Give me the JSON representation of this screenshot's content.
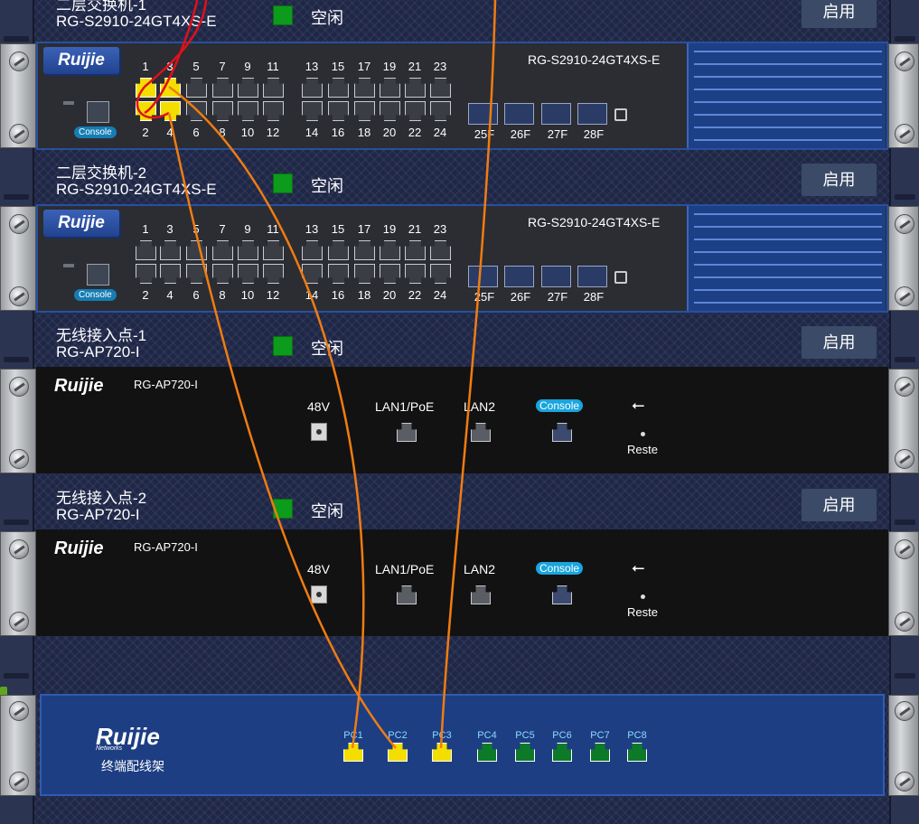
{
  "devices": [
    {
      "name_line1": "二层交换机-1",
      "name_line2": "RG-S2910-24GT4XS-E",
      "status": "空闲",
      "enable_label": "启用",
      "brand": "Ruijie",
      "model": "RG-S2910-24GT4XS-E",
      "console_label": "Console",
      "odd_ports": [
        "1",
        "3",
        "5",
        "7",
        "9",
        "11",
        "13",
        "15",
        "17",
        "19",
        "21",
        "23"
      ],
      "even_ports": [
        "2",
        "4",
        "6",
        "8",
        "10",
        "12",
        "14",
        "16",
        "18",
        "20",
        "22",
        "24"
      ],
      "sfp_ports": [
        "25F",
        "26F",
        "27F",
        "28F"
      ],
      "active_ports": [
        "1",
        "2",
        "3",
        "4"
      ]
    },
    {
      "name_line1": "二层交换机-2",
      "name_line2": "RG-S2910-24GT4XS-E",
      "status": "空闲",
      "enable_label": "启用",
      "brand": "Ruijie",
      "model": "RG-S2910-24GT4XS-E",
      "console_label": "Console",
      "odd_ports": [
        "1",
        "3",
        "5",
        "7",
        "9",
        "11",
        "13",
        "15",
        "17",
        "19",
        "21",
        "23"
      ],
      "even_ports": [
        "2",
        "4",
        "6",
        "8",
        "10",
        "12",
        "14",
        "16",
        "18",
        "20",
        "22",
        "24"
      ],
      "sfp_ports": [
        "25F",
        "26F",
        "27F",
        "28F"
      ],
      "active_ports": []
    },
    {
      "name_line1": "无线接入点-1",
      "name_line2": "RG-AP720-I",
      "status": "空闲",
      "enable_label": "启用",
      "brand": "Ruijie",
      "model": "RG-AP720-I",
      "power_label": "48V",
      "lan1_label": "LAN1/PoE",
      "lan2_label": "LAN2",
      "console_label": "Console",
      "reset_label": "Reste"
    },
    {
      "name_line1": "无线接入点-2",
      "name_line2": "RG-AP720-I",
      "status": "空闲",
      "enable_label": "启用",
      "brand": "Ruijie",
      "model": "RG-AP720-I",
      "power_label": "48V",
      "lan1_label": "LAN1/PoE",
      "lan2_label": "LAN2",
      "console_label": "Console",
      "reset_label": "Reste"
    }
  ],
  "patch_panel": {
    "brand": "Ruijie",
    "brand_sub": "Networks",
    "caption": "终端配线架",
    "ports": [
      {
        "label": "PC1",
        "state": "connected"
      },
      {
        "label": "PC2",
        "state": "connected"
      },
      {
        "label": "PC3",
        "state": "connected"
      },
      {
        "label": "PC4",
        "state": "free"
      },
      {
        "label": "PC5",
        "state": "free"
      },
      {
        "label": "PC6",
        "state": "free"
      },
      {
        "label": "PC7",
        "state": "free"
      },
      {
        "label": "PC8",
        "state": "free"
      }
    ]
  },
  "colors": {
    "status_idle": "#0c9b1a",
    "port_active": "#f4de00",
    "port_free_patch": "#0d7a2a",
    "cable_red": "#e0101a",
    "cable_orange": "#f07c12"
  },
  "icons": {
    "usb": "usb-icon",
    "screw": "screw-icon",
    "lock": "lock-icon"
  }
}
